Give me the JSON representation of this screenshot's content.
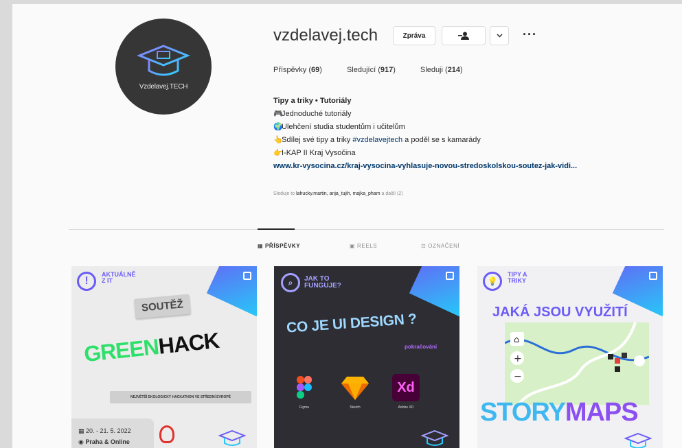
{
  "profile": {
    "username": "vzdelavej.tech",
    "avatar_text": "Vzdelavej.TECH",
    "buttons": {
      "message": "Zpráva",
      "follow_icon": "person-add-icon",
      "dropdown_icon": "chevron-down-icon",
      "more": "···"
    },
    "stats": {
      "posts_label": "Příspěvky",
      "posts_count": "69",
      "followers_label": "Sledující",
      "followers_count": "917",
      "following_label": "Sleduji",
      "following_count": "214"
    },
    "bio": {
      "name": "Tipy a triky • Tutoriály",
      "line1": "Jednoduché tutoriály",
      "line2": "Ulehčení studia studentům i učitelům",
      "line3_prefix": "Sdílej své tipy a triky ",
      "line3_tag": "#vzdelavejtech",
      "line3_suffix": " a poděl se s kamarády",
      "line4": "I-KAP II Kraj Vysočina",
      "link": "www.kr-vysocina.cz/kraj-vysocina-vyhlasuje-novou-stredoskolskou-soutez-jak-vidi..."
    },
    "followed_by": {
      "prefix": "Sleduje to",
      "names": "lahucky.martin, anja_tujih, majka_pham",
      "suffix": "a další (2)"
    }
  },
  "tabs": [
    {
      "label": "PŘÍSPĚVKY",
      "icon": "grid-icon",
      "active": true
    },
    {
      "label": "REELS",
      "icon": "reels-icon",
      "active": false
    },
    {
      "label": "OZNAČENÍ",
      "icon": "tagged-icon",
      "active": false
    }
  ],
  "posts": [
    {
      "head": "AKTUÁLNĚ Z IT",
      "badge": "SOUTĚŽ",
      "title_green": "GREEN",
      "title_black": "HACK",
      "bar": "NEJVĚTŠÍ EKOLOGICKÝ HACKATHON VE STŘEDNÍ EVROPĚ",
      "date": "20. - 21. 5. 2022",
      "place": "Praha & Online"
    },
    {
      "head": "JAK TO FUNGUJE?",
      "title": "CO JE UI DESIGN ?",
      "sub": "pokračování",
      "apps": [
        "Figma",
        "Sketch",
        "Adobe XD"
      ],
      "xd_label": "Xd"
    },
    {
      "head": "TIPY A TRIKY",
      "title": "JAKÁ JSOU VYUŽITÍ",
      "big_a": "STORY",
      "big_b": "MAPS"
    }
  ],
  "colors": {
    "link": "#00376b",
    "accent": "#6b5cf6",
    "green": "#2ee06a",
    "cyan": "#27c7f7"
  }
}
